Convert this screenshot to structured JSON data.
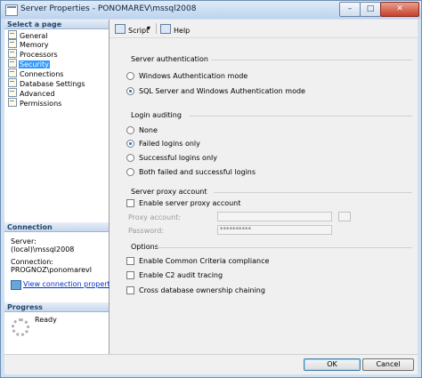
{
  "window": {
    "title": "Server Properties - PONOMAREV\\mssql2008",
    "minimize_glyph": "–",
    "maximize_glyph": "□",
    "close_glyph": "✕"
  },
  "left_panel": {
    "select_page_header": "Select a page",
    "pages": [
      {
        "label": "General",
        "selected": false
      },
      {
        "label": "Memory",
        "selected": false
      },
      {
        "label": "Processors",
        "selected": false
      },
      {
        "label": "Security",
        "selected": true
      },
      {
        "label": "Connections",
        "selected": false
      },
      {
        "label": "Database Settings",
        "selected": false
      },
      {
        "label": "Advanced",
        "selected": false
      },
      {
        "label": "Permissions",
        "selected": false
      }
    ],
    "connection_header": "Connection",
    "server_label": "Server:",
    "server_value": "(local)\\mssql2008",
    "connection_label": "Connection:",
    "connection_value": "PROGNOZ\\ponomarevl",
    "view_connection_link": "View connection properties",
    "progress_header": "Progress",
    "progress_status": "Ready"
  },
  "toolbar": {
    "script_label": "Script",
    "script_dropdown_glyph": "▾",
    "help_label": "Help",
    "script_icon": "script-icon",
    "help_icon": "help-icon"
  },
  "security": {
    "server_authentication": {
      "label": "Server authentication",
      "options": [
        {
          "label": "Windows Authentication mode",
          "selected": false
        },
        {
          "label": "SQL Server and Windows Authentication mode",
          "selected": true
        }
      ]
    },
    "login_auditing": {
      "label": "Login auditing",
      "options": [
        {
          "label": "None",
          "selected": false
        },
        {
          "label": "Failed logins only",
          "selected": true
        },
        {
          "label": "Successful logins only",
          "selected": false
        },
        {
          "label": "Both failed and successful logins",
          "selected": false
        }
      ]
    },
    "proxy": {
      "label": "Server proxy account",
      "enable_label": "Enable server proxy account",
      "enabled": false,
      "proxy_account_label": "Proxy account:",
      "proxy_account_value": "",
      "password_label": "Password:",
      "password_value": "**********"
    },
    "options": {
      "label": "Options",
      "items": [
        {
          "label": "Enable Common Criteria compliance",
          "checked": false
        },
        {
          "label": "Enable C2 audit tracing",
          "checked": false
        },
        {
          "label": "Cross database ownership chaining",
          "checked": false
        }
      ]
    }
  },
  "buttons": {
    "ok": "OK",
    "cancel": "Cancel"
  }
}
